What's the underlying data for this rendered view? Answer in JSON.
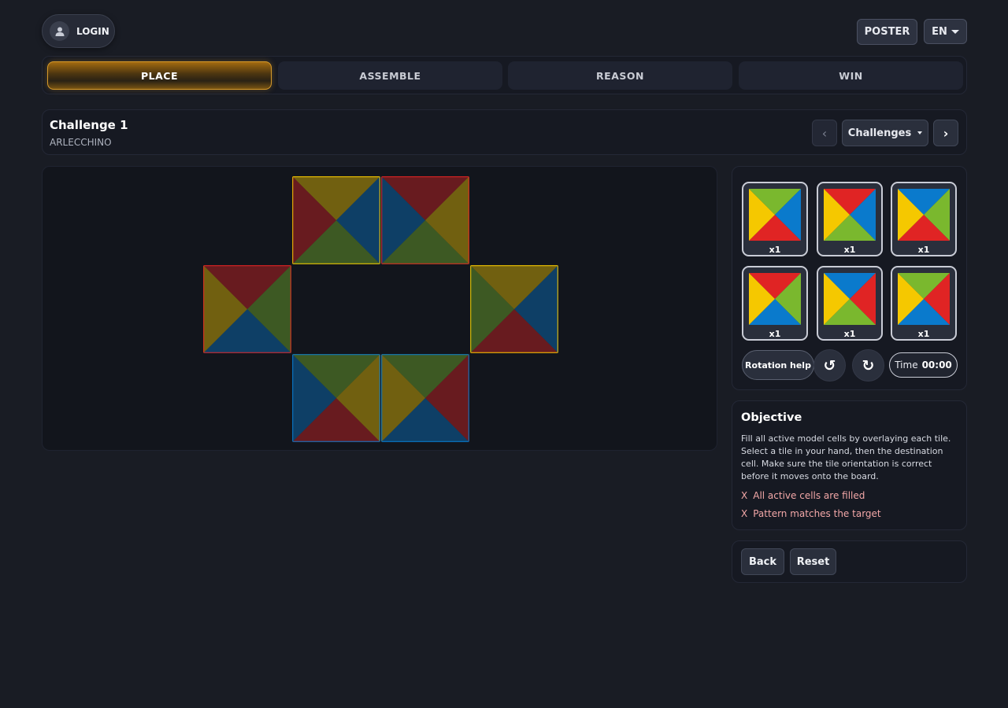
{
  "header": {
    "login_label": "LOGIN",
    "poster_label": "POSTER",
    "language": "EN"
  },
  "steps": [
    {
      "label": "PLACE",
      "active": true
    },
    {
      "label": "ASSEMBLE",
      "active": false
    },
    {
      "label": "REASON",
      "active": false
    },
    {
      "label": "WIN",
      "active": false
    }
  ],
  "challenge": {
    "title": "Challenge 1",
    "subtitle": "ARLECCHINO",
    "prev_symbol": "‹",
    "next_symbol": "›",
    "selector_label": "Challenges"
  },
  "colors": {
    "yellow": "#f5c800",
    "red": "#e02424",
    "blue": "#0a7acc",
    "green": "#7ab82e",
    "accent": "#d79a2a"
  },
  "board": {
    "placed_cells": [
      {
        "top": "yellow",
        "right": "blue",
        "bottom": "green",
        "left": "red",
        "border": "yellow"
      },
      {
        "top": "red",
        "right": "yellow",
        "bottom": "green",
        "left": "blue",
        "border": "red"
      },
      {
        "top": "red",
        "right": "green",
        "bottom": "blue",
        "left": "yellow",
        "border": "red"
      },
      {
        "top": "yellow",
        "right": "blue",
        "bottom": "red",
        "left": "green",
        "border": "yellow"
      },
      {
        "top": "green",
        "right": "yellow",
        "bottom": "red",
        "left": "blue",
        "border": "blue"
      },
      {
        "top": "green",
        "right": "red",
        "bottom": "blue",
        "left": "yellow",
        "border": "blue"
      }
    ]
  },
  "hand": {
    "tiles": [
      {
        "top": "green",
        "right": "blue",
        "bottom": "red",
        "left": "yellow",
        "count": "x1"
      },
      {
        "top": "red",
        "right": "blue",
        "bottom": "green",
        "left": "yellow",
        "count": "x1"
      },
      {
        "top": "blue",
        "right": "green",
        "bottom": "red",
        "left": "yellow",
        "count": "x1"
      },
      {
        "top": "red",
        "right": "green",
        "bottom": "blue",
        "left": "yellow",
        "count": "x1"
      },
      {
        "top": "blue",
        "right": "red",
        "bottom": "green",
        "left": "yellow",
        "count": "x1"
      },
      {
        "top": "green",
        "right": "red",
        "bottom": "blue",
        "left": "yellow",
        "count": "x1"
      }
    ],
    "rotation_help_label": "Rotation help",
    "rotate_left_symbol": "↺",
    "rotate_right_symbol": "↻",
    "time_label": "Time",
    "time_value": "00:00"
  },
  "objective": {
    "title": "Objective",
    "text": "Fill all active model cells by overlaying each tile. Select a tile in your hand, then the destination cell. Make sure the tile orientation is correct before it moves onto the board.",
    "checks": [
      {
        "mark": "X",
        "label": "All active cells are filled"
      },
      {
        "mark": "X",
        "label": "Pattern matches the target"
      }
    ]
  },
  "actions": {
    "back_label": "Back",
    "reset_label": "Reset"
  }
}
